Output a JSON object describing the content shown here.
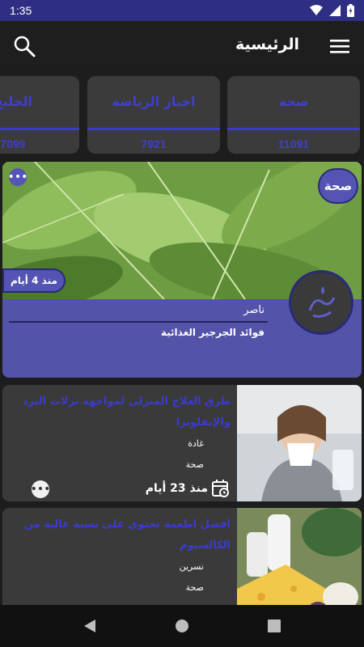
{
  "status_bar": {
    "time": "1:35",
    "icons": [
      "wifi-icon",
      "signal-icon",
      "battery-icon"
    ]
  },
  "header": {
    "title": "الرئيسية",
    "search_icon": "search-icon",
    "menu_icon": "menu-icon"
  },
  "categories": [
    {
      "name": "صحة",
      "count": "11091"
    },
    {
      "name": "اخبار الرياضة",
      "count": "7921"
    },
    {
      "name": "الخليج",
      "count": "7099"
    }
  ],
  "featured": {
    "category": "صحة",
    "age": "منذ 4 أيام",
    "author": "ناصر",
    "title": "فوائد الجرجير الغذائية",
    "more_icon": "more-icon"
  },
  "articles": [
    {
      "title": "طرق العلاج المنزلي لمواجهة نزلات البرد والإنفلونزا",
      "author": "غادة",
      "category": "صحة",
      "date": "منذ 23 أيام"
    },
    {
      "title": "افضل اطعمة تحتوي على نسبة عالية من الكالسيوم",
      "author": "نسرين",
      "category": "صحة",
      "date": ""
    }
  ],
  "colors": {
    "accent": "#3a3ad0",
    "status_bar": "#2e2e83",
    "featured_bg": "#5353a8",
    "card_bg": "#3a3a3a",
    "background": "#1d1d1d"
  },
  "nav": [
    "back-icon",
    "home-icon",
    "recents-icon"
  ]
}
